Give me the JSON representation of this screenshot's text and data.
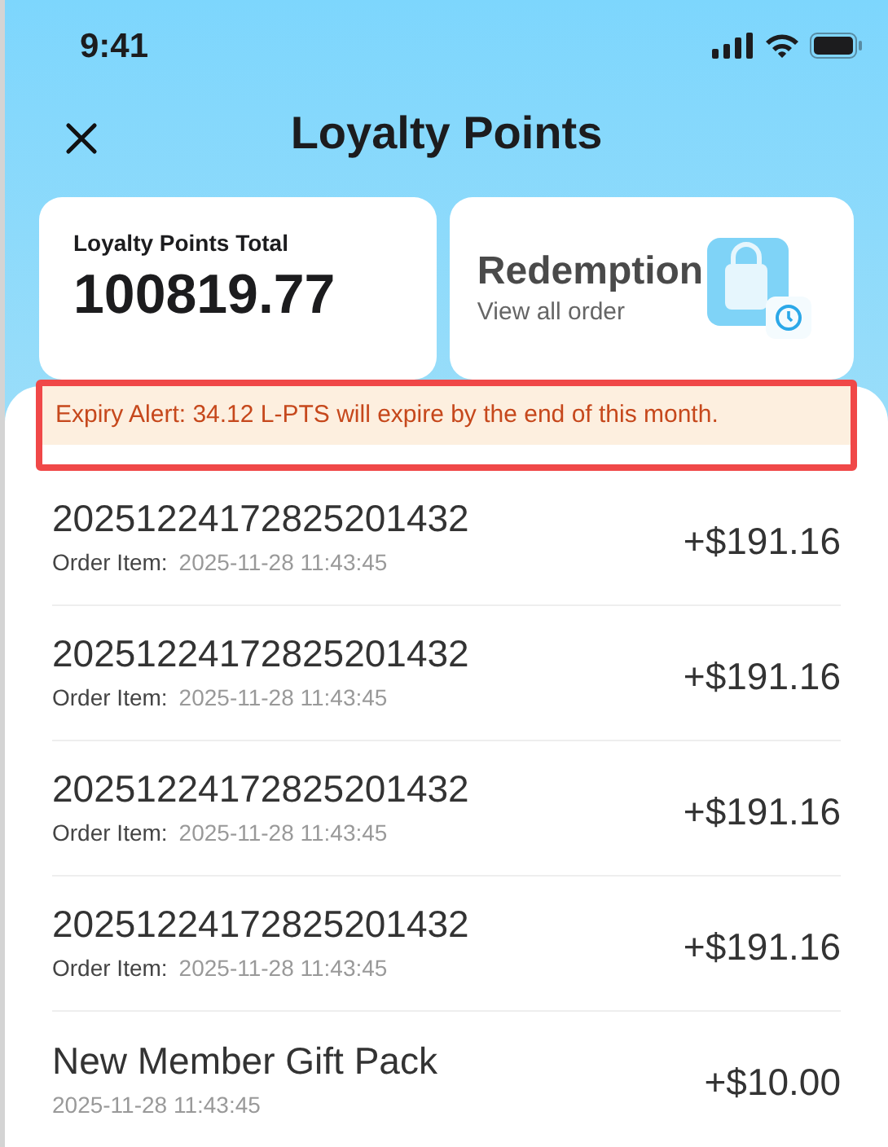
{
  "status_bar": {
    "time": "9:41"
  },
  "header": {
    "title": "Loyalty Points"
  },
  "total_card": {
    "label": "Loyalty Points Total",
    "value": "100819.77"
  },
  "redemption_card": {
    "title": "Redemption",
    "subtitle": "View all order"
  },
  "alert": {
    "text": "Expiry Alert: 34.12 L-PTS will expire by the end of this month."
  },
  "transactions": [
    {
      "title": "20251224172825201432",
      "label": "Order Item:",
      "date": "2025-11-28 11:43:45",
      "amount": "+$191.16"
    },
    {
      "title": "20251224172825201432",
      "label": "Order Item:",
      "date": "2025-11-28 11:43:45",
      "amount": "+$191.16"
    },
    {
      "title": "20251224172825201432",
      "label": "Order Item:",
      "date": "2025-11-28 11:43:45",
      "amount": "+$191.16"
    },
    {
      "title": "20251224172825201432",
      "label": "Order Item:",
      "date": "2025-11-28 11:43:45",
      "amount": "+$191.16"
    },
    {
      "title": "New Member Gift Pack",
      "date": "2025-11-28 11:43:45",
      "amount": "+$10.00"
    }
  ]
}
